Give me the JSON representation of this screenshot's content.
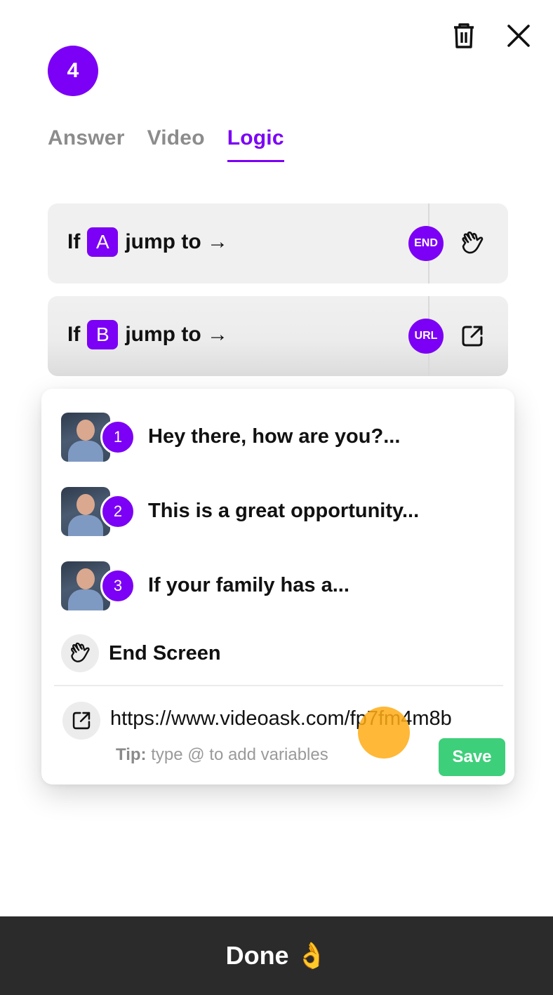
{
  "header": {
    "step_number": "4",
    "delete_icon": "trash-icon",
    "close_icon": "close-icon"
  },
  "tabs": [
    {
      "label": "Answer",
      "active": false
    },
    {
      "label": "Video",
      "active": false
    },
    {
      "label": "Logic",
      "active": true
    }
  ],
  "rules": [
    {
      "prefix": "If",
      "option": "A",
      "suffix": "jump to →",
      "destination_badge": "END",
      "destination_icon": "waving-hand-icon"
    },
    {
      "prefix": "If",
      "option": "B",
      "suffix": "jump to →",
      "destination_badge": "URL",
      "destination_icon": "external-link-icon"
    }
  ],
  "dropdown": {
    "questions": [
      {
        "number": "1",
        "text": "Hey there, how are you?..."
      },
      {
        "number": "2",
        "text": "This is a great opportunity..."
      },
      {
        "number": "3",
        "text": "If your family has a..."
      }
    ],
    "end_screen_label": "End Screen",
    "url_value": "https://www.videoask.com/fp7fm4m8b",
    "tip_label": "Tip:",
    "tip_text": " type @ to add variables",
    "save_label": "Save"
  },
  "footer": {
    "done_label": "Done 👌"
  },
  "colors": {
    "accent": "#7b00f5",
    "save_green": "#3ecf7a",
    "footer_bg": "#2b2b2b",
    "cursor_highlight": "#ffac14"
  }
}
